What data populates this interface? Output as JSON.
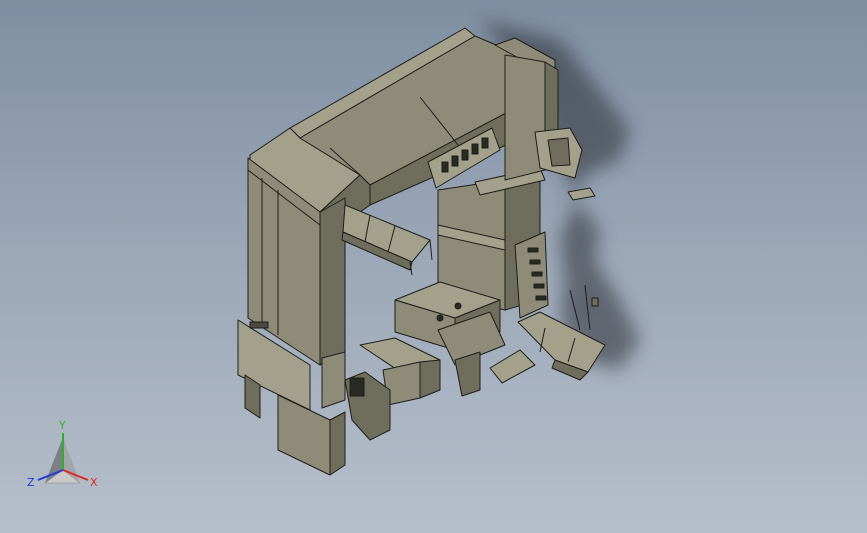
{
  "viewport": {
    "background_top": "#7f8ea2",
    "background_bottom": "#b6bfcb",
    "model_fill": "#8e8c78",
    "model_fill_light": "#a3a18c",
    "model_fill_dark": "#6f6d5c",
    "edge_color": "#1e1e1a",
    "shadow_color": "#2a2e36"
  },
  "triad": {
    "x_label": "X",
    "y_label": "Y",
    "z_label": "Z",
    "x_color": "#e0281e",
    "y_color": "#2fae2f",
    "z_color": "#2238d8"
  }
}
